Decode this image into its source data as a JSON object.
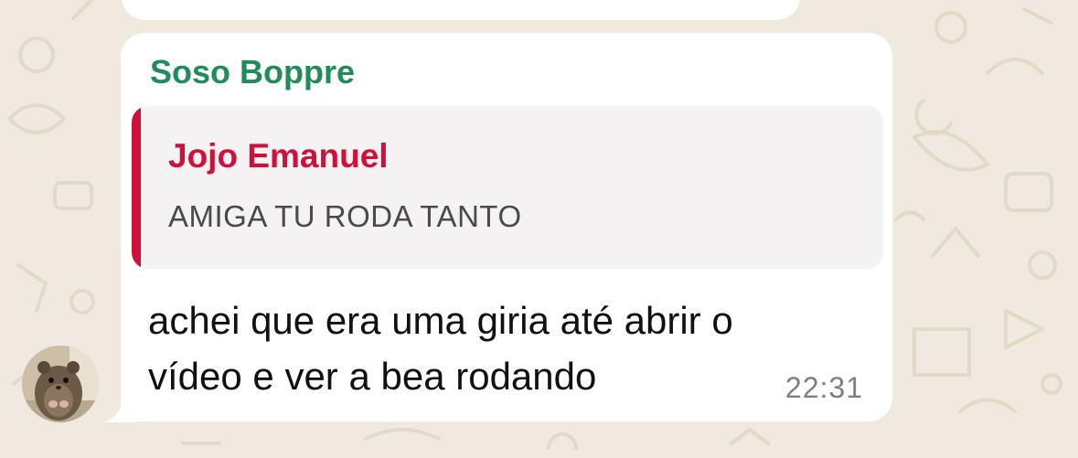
{
  "chat": {
    "background_color": "#efe9df",
    "message": {
      "sender_name": "Soso Boppre",
      "sender_color": "#1f8c5a",
      "reply": {
        "author": "Jojo Emanuel",
        "author_color": "#d0103a",
        "text": "AMIGA TU RODA TANTO"
      },
      "body_line1": "achei que era uma giria até abrir o",
      "body_line2": "vídeo e ver a bea rodando",
      "time": "22:31"
    },
    "avatar_icon": "hamster-avatar"
  }
}
